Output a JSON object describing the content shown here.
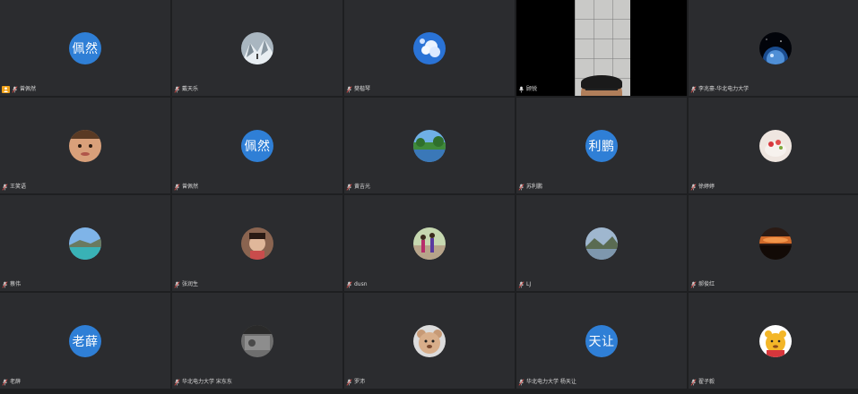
{
  "participants": [
    {
      "name": "曾佩然",
      "avatar_type": "text",
      "avatar_text": "佩然",
      "avatar_color": "#2f7fd6",
      "is_host": true,
      "mic_icon": "mic-muted-icon"
    },
    {
      "name": "戴天乐",
      "avatar_type": "image",
      "avatar_image": "snowy-mountain",
      "mic_icon": "mic-muted-icon"
    },
    {
      "name": "樊楷琴",
      "avatar_type": "image",
      "avatar_image": "blue-sky-clouds",
      "mic_icon": "mic-muted-icon"
    },
    {
      "name": "顾锐",
      "avatar_type": "video",
      "mic_icon": "mic-on-icon"
    },
    {
      "name": "李兆豪-华北电力大学",
      "avatar_type": "image",
      "avatar_image": "earth-at-night",
      "mic_icon": "mic-muted-icon"
    },
    {
      "name": "王笑语",
      "avatar_type": "image",
      "avatar_image": "child-face",
      "mic_icon": "mic-muted-icon"
    },
    {
      "name": "曾佩然",
      "avatar_type": "text",
      "avatar_text": "佩然",
      "avatar_color": "#2f7fd6",
      "mic_icon": "mic-muted-icon"
    },
    {
      "name": "黄吉光",
      "avatar_type": "image",
      "avatar_image": "lake-trees",
      "mic_icon": "mic-muted-icon"
    },
    {
      "name": "苏利鹏",
      "avatar_type": "text",
      "avatar_text": "利鹏",
      "avatar_color": "#2f7fd6",
      "mic_icon": "mic-muted-icon"
    },
    {
      "name": "徐婷婷",
      "avatar_type": "image",
      "avatar_image": "cake",
      "mic_icon": "mic-muted-icon"
    },
    {
      "name": "蔡伟",
      "avatar_type": "image",
      "avatar_image": "turquoise-lake",
      "mic_icon": "mic-muted-icon"
    },
    {
      "name": "张润生",
      "avatar_type": "image",
      "avatar_image": "person-selfie",
      "mic_icon": "mic-muted-icon"
    },
    {
      "name": "dusn",
      "avatar_type": "image",
      "avatar_image": "park-people",
      "mic_icon": "mic-muted-icon"
    },
    {
      "name": "LJ",
      "avatar_type": "image",
      "avatar_image": "mountain-lake",
      "mic_icon": "mic-muted-icon"
    },
    {
      "name": "郝俊红",
      "avatar_type": "image",
      "avatar_image": "sunset-clouds",
      "mic_icon": "mic-muted-icon"
    },
    {
      "name": "老薛",
      "avatar_type": "text",
      "avatar_text": "老薛",
      "avatar_color": "#2f7fd6",
      "mic_icon": "mic-muted-icon"
    },
    {
      "name": "华北电力大学 宋东东",
      "avatar_type": "image",
      "avatar_image": "grayscale-photo",
      "mic_icon": "mic-muted-icon"
    },
    {
      "name": "罗沛",
      "avatar_type": "image",
      "avatar_image": "teddy-bear",
      "mic_icon": "mic-muted-icon"
    },
    {
      "name": "华北电力大学 杨天让",
      "avatar_type": "text",
      "avatar_text": "天让",
      "avatar_color": "#2f7fd6",
      "mic_icon": "mic-muted-icon"
    },
    {
      "name": "翟子毅",
      "avatar_type": "image",
      "avatar_image": "winnie-the-pooh",
      "mic_icon": "mic-muted-icon"
    }
  ],
  "colors": {
    "background": "#1e1f21",
    "tile": "#2b2c2f",
    "avatar_blue": "#2f7fd6",
    "host_badge": "#f0a21b",
    "name_text": "#d8d8d8"
  }
}
